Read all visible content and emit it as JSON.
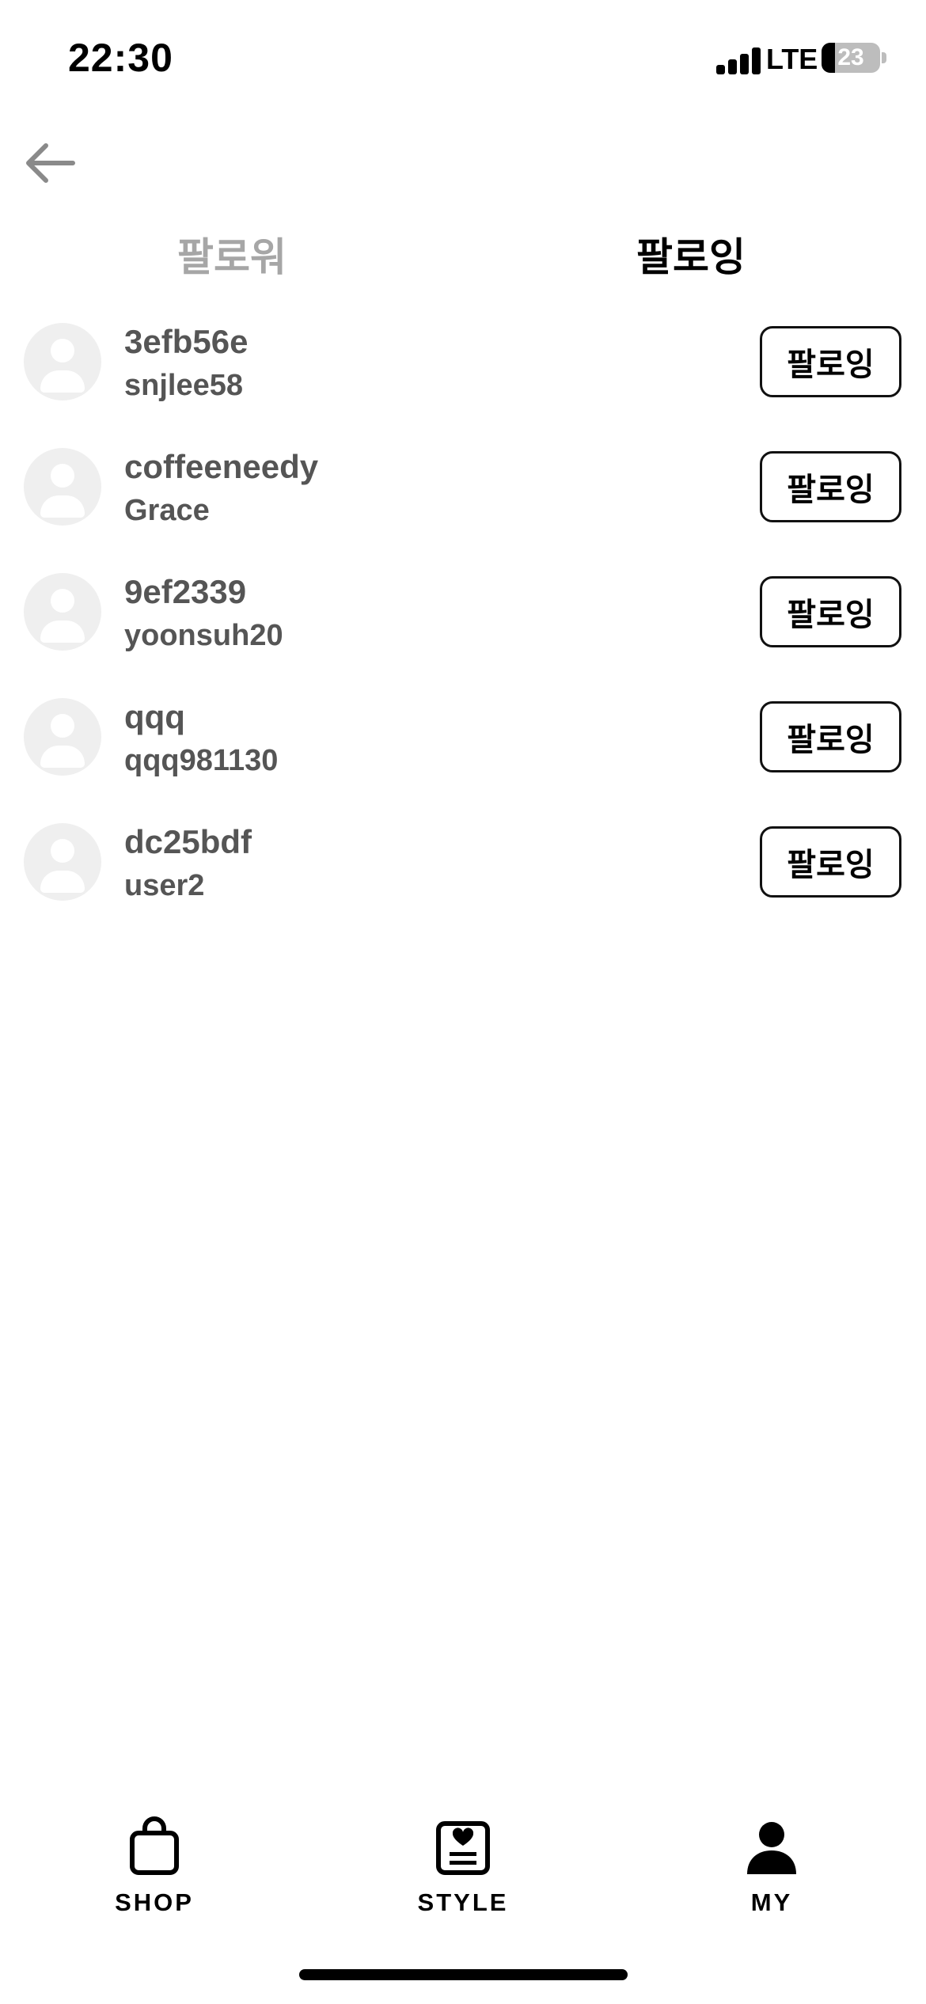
{
  "status_bar": {
    "time": "22:30",
    "network": "LTE",
    "battery": "23"
  },
  "header": {
    "back_icon": "arrow-left-icon"
  },
  "tabs": [
    {
      "label": "팔로워",
      "active": false
    },
    {
      "label": "팔로잉",
      "active": true
    }
  ],
  "users": [
    {
      "id": "3efb56e",
      "name": "snjlee58",
      "button": "팔로잉"
    },
    {
      "id": "coffeeneedy",
      "name": "Grace",
      "button": "팔로잉"
    },
    {
      "id": "9ef2339",
      "name": "yoonsuh20",
      "button": "팔로잉"
    },
    {
      "id": "qqq",
      "name": "qqq981130",
      "button": "팔로잉"
    },
    {
      "id": "dc25bdf",
      "name": "user2",
      "button": "팔로잉"
    }
  ],
  "bottom_nav": [
    {
      "label": "SHOP",
      "icon": "shopping-bag-icon"
    },
    {
      "label": "STYLE",
      "icon": "style-feed-icon"
    },
    {
      "label": "MY",
      "icon": "person-icon"
    }
  ],
  "colors": {
    "active_tab": "#000000",
    "inactive_tab": "#a6a6a6",
    "user_text": "#555555",
    "avatar_bg": "#efefef"
  }
}
